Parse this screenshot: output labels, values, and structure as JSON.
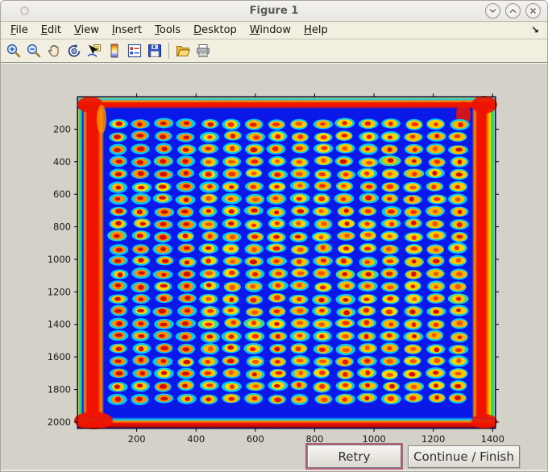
{
  "window": {
    "title": "Figure 1",
    "controls": [
      {
        "name": "minimize",
        "icon": "chevron-down-icon"
      },
      {
        "name": "maximize",
        "icon": "chevron-up-icon"
      },
      {
        "name": "close",
        "icon": "close-x-icon"
      }
    ]
  },
  "menubar": {
    "items": [
      {
        "label": "File"
      },
      {
        "label": "Edit"
      },
      {
        "label": "View"
      },
      {
        "label": "Insert"
      },
      {
        "label": "Tools"
      },
      {
        "label": "Desktop"
      },
      {
        "label": "Window"
      },
      {
        "label": "Help"
      }
    ],
    "dock_arrow": "↘"
  },
  "toolbar": {
    "icons": [
      {
        "name": "zoom-in",
        "tooltip": "Zoom In"
      },
      {
        "name": "zoom-out",
        "tooltip": "Zoom Out"
      },
      {
        "name": "pan",
        "tooltip": "Pan"
      },
      {
        "name": "rotate-3d",
        "tooltip": "Rotate 3D"
      },
      {
        "name": "data-cursor",
        "tooltip": "Data Cursor"
      },
      {
        "name": "colorbar",
        "tooltip": "Insert Colorbar"
      },
      {
        "name": "legend",
        "tooltip": "Insert Legend"
      },
      {
        "name": "save",
        "tooltip": "Save Figure"
      },
      {
        "name": "separator",
        "tooltip": ""
      },
      {
        "name": "open",
        "tooltip": "Open File"
      },
      {
        "name": "print",
        "tooltip": "Print Figure"
      }
    ]
  },
  "buttons": {
    "retry": "Retry",
    "continue_finish": "Continue / Finish"
  },
  "theme": {
    "figure_bg": "#d4d1c9",
    "chrome_bg": "#f2eee0",
    "retry_focus_ring": "#b25c7e"
  },
  "chart_data": {
    "type": "heatmap",
    "title": "",
    "xlabel": "",
    "ylabel": "",
    "description": "Jet-colormap image of a scanned microarray plate: regular grid of spots (red-orange centers, yellow rings, cyan halos) on a saturated blue background with red-hot plate edges on all four sides",
    "x_ticks": [
      200,
      400,
      600,
      800,
      1000,
      1200,
      1400
    ],
    "y_ticks": [
      200,
      400,
      600,
      800,
      1000,
      1200,
      1400,
      1600,
      1800,
      2000
    ],
    "x_range": [
      0,
      1410
    ],
    "y_range": [
      0,
      2040
    ],
    "y_direction": "reverse",
    "grid": {
      "columns": 16,
      "rows": 23
    },
    "colormap": "jet",
    "colors": {
      "background": "#0a18e8",
      "spot_center": [
        "#d01000",
        "#e02000",
        "#ee3300",
        "#f05800"
      ],
      "spot_ring": [
        "#ffc800",
        "#ffd400",
        "#ffb400",
        "#f5c000"
      ],
      "spot_halo": "#00d4ff",
      "anomaly_halo": "#30e0b0",
      "band_red": "#ee1400",
      "band_orange": "#ff9000",
      "band_yellow": "#ffd800",
      "band_cyan": "#00ccff",
      "band_green": "#60d000",
      "band_dark_red": "#7a0000",
      "axis": "#000000",
      "tick_label": "#1a1a1a"
    }
  }
}
